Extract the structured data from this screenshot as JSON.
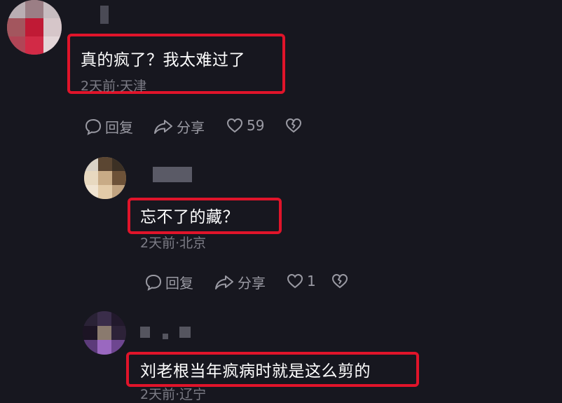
{
  "comments": [
    {
      "text": "真的疯了？我太难过了",
      "meta": "2天前·天津",
      "reply_label": "回复",
      "share_label": "分享",
      "likes": "59"
    },
    {
      "text": "忘不了的藏？",
      "meta": "2天前·北京",
      "reply_label": "回复",
      "share_label": "分享",
      "likes": "1"
    },
    {
      "text": "刘老根当年疯病时就是这么剪的",
      "meta": "2天前·辽宁"
    }
  ],
  "colors": {
    "background": "#17171f",
    "highlight_box": "#e0142a",
    "meta_text": "#7c7c86",
    "action_text": "#9a9aa3"
  },
  "icons": [
    "comment-bubble-icon",
    "share-arrow-icon",
    "heart-icon",
    "broken-heart-icon"
  ]
}
